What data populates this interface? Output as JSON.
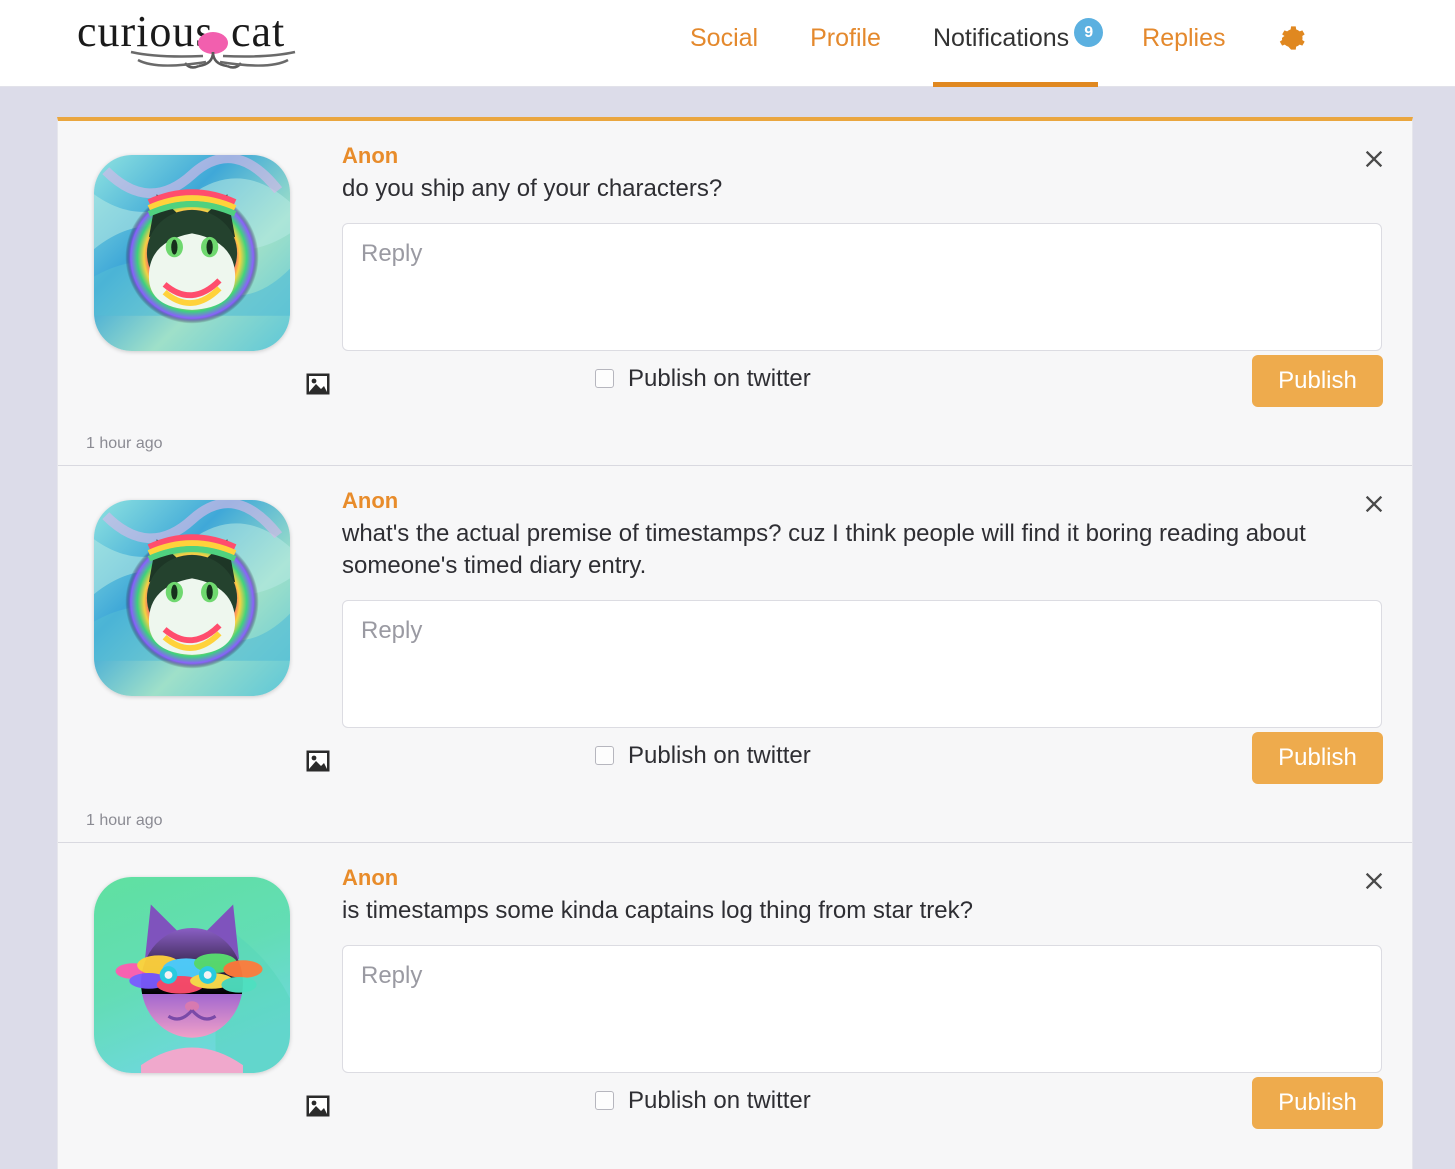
{
  "brand": {
    "logo_text_left": "curious",
    "logo_text_right": "cat",
    "logo_nose_color": "#f25fae"
  },
  "nav": {
    "items": [
      {
        "label": "Social",
        "active": false
      },
      {
        "label": "Profile",
        "active": false
      },
      {
        "label": "Notifications",
        "active": true,
        "badge": "9"
      },
      {
        "label": "Replies",
        "active": false
      }
    ],
    "settings_icon": "gear-icon",
    "active_color": "#333333",
    "link_color": "#e4892d",
    "underline_color": "#e08820",
    "badge_color": "#5bb0e0"
  },
  "feed": {
    "accent_top_border": "#eaa63f",
    "notifications": [
      {
        "author": "Anon",
        "question": "do you ship any of your characters?",
        "reply_placeholder": "Reply",
        "reply_value": "",
        "twitter_label": "Publish on twitter",
        "twitter_checked": false,
        "publish_label": "Publish",
        "timestamp": "1 hour ago",
        "avatar": "psychedelic-rainbow-cat",
        "image_icon": "image-upload-icon",
        "close_icon": "close-icon"
      },
      {
        "author": "Anon",
        "question": "what's the actual premise of timestamps? cuz I think people will find it boring reading about someone's timed diary entry.",
        "reply_placeholder": "Reply",
        "reply_value": "",
        "twitter_label": "Publish on twitter",
        "twitter_checked": false,
        "publish_label": "Publish",
        "timestamp": "1 hour ago",
        "avatar": "psychedelic-rainbow-cat",
        "image_icon": "image-upload-icon",
        "close_icon": "close-icon"
      },
      {
        "author": "Anon",
        "question": "is timestamps some kinda captains log thing from star trek?",
        "reply_placeholder": "Reply",
        "reply_value": "",
        "twitter_label": "Publish on twitter",
        "twitter_checked": false,
        "publish_label": "Publish",
        "timestamp": "",
        "avatar": "purple-glitch-cat",
        "image_icon": "image-upload-icon",
        "close_icon": "close-icon"
      }
    ]
  }
}
